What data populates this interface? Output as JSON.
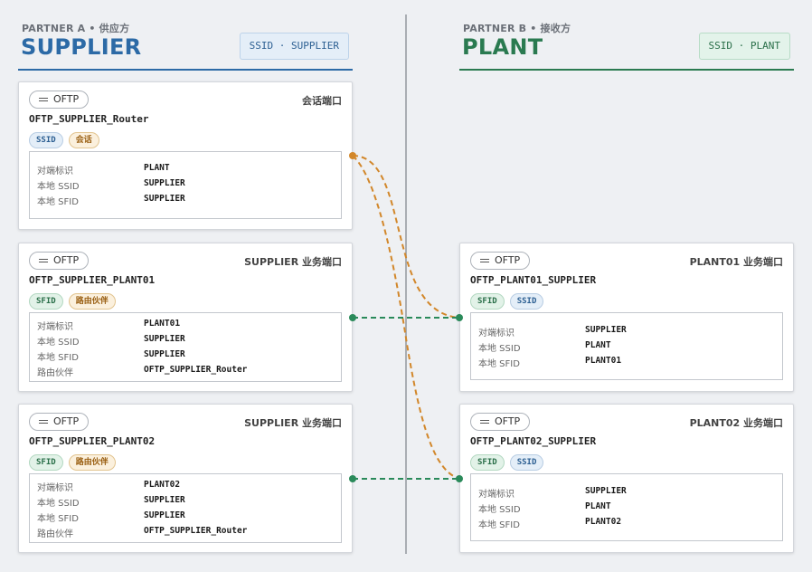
{
  "colors": {
    "blue": "#2c6aa6",
    "green": "#2a7a50",
    "amber": "#d2872a",
    "link_green": "#2a8a5a"
  },
  "partners": {
    "left": {
      "sub": "PARTNER A • 供应方",
      "title": "SUPPLIER",
      "chip": "SSID · SUPPLIER"
    },
    "right": {
      "sub": "PARTNER B • 接收方",
      "title": "PLANT",
      "chip": "SSID · PLANT"
    }
  },
  "cards": {
    "c1": {
      "pill": "OFTP",
      "role": "会话端口",
      "name": "OFTP_SUPPLIER_Router",
      "tags": [
        "SSID",
        "会话"
      ],
      "props": [
        {
          "k": "对端标识",
          "v": "PLANT"
        },
        {
          "k": "本地 SSID",
          "v": "SUPPLIER"
        },
        {
          "k": "本地 SFID",
          "v": "SUPPLIER"
        }
      ]
    },
    "c2": {
      "pill": "OFTP",
      "role": "SUPPLIER 业务端口",
      "name": "OFTP_SUPPLIER_PLANT01",
      "tags": [
        "SFID",
        "路由伙伴"
      ],
      "props": [
        {
          "k": "对端标识",
          "v": "PLANT01"
        },
        {
          "k": "本地 SSID",
          "v": "SUPPLIER"
        },
        {
          "k": "本地 SFID",
          "v": "SUPPLIER"
        },
        {
          "k": "路由伙伴",
          "v": "OFTP_SUPPLIER_Router"
        }
      ]
    },
    "c3": {
      "pill": "OFTP",
      "role": "SUPPLIER 业务端口",
      "name": "OFTP_SUPPLIER_PLANT02",
      "tags": [
        "SFID",
        "路由伙伴"
      ],
      "props": [
        {
          "k": "对端标识",
          "v": "PLANT02"
        },
        {
          "k": "本地 SSID",
          "v": "SUPPLIER"
        },
        {
          "k": "本地 SFID",
          "v": "SUPPLIER"
        },
        {
          "k": "路由伙伴",
          "v": "OFTP_SUPPLIER_Router"
        }
      ]
    },
    "c4": {
      "pill": "OFTP",
      "role": "PLANT01 业务端口",
      "name": "OFTP_PLANT01_SUPPLIER",
      "tags": [
        "SFID",
        "SSID"
      ],
      "props": [
        {
          "k": "对端标识",
          "v": "SUPPLIER"
        },
        {
          "k": "本地 SSID",
          "v": "PLANT"
        },
        {
          "k": "本地 SFID",
          "v": "PLANT01"
        }
      ]
    },
    "c5": {
      "pill": "OFTP",
      "role": "PLANT02 业务端口",
      "name": "OFTP_PLANT02_SUPPLIER",
      "tags": [
        "SFID",
        "SSID"
      ],
      "props": [
        {
          "k": "对端标识",
          "v": "SUPPLIER"
        },
        {
          "k": "本地 SSID",
          "v": "PLANT"
        },
        {
          "k": "本地 SFID",
          "v": "PLANT02"
        }
      ]
    }
  },
  "links": [
    {
      "from": "c1",
      "to": "c4",
      "style": "dashed",
      "color": "amber"
    },
    {
      "from": "c1",
      "to": "c5",
      "style": "dashed",
      "color": "amber"
    },
    {
      "from": "c2",
      "to": "c4",
      "style": "dashed",
      "color": "link_green"
    },
    {
      "from": "c3",
      "to": "c5",
      "style": "dashed",
      "color": "link_green"
    }
  ]
}
